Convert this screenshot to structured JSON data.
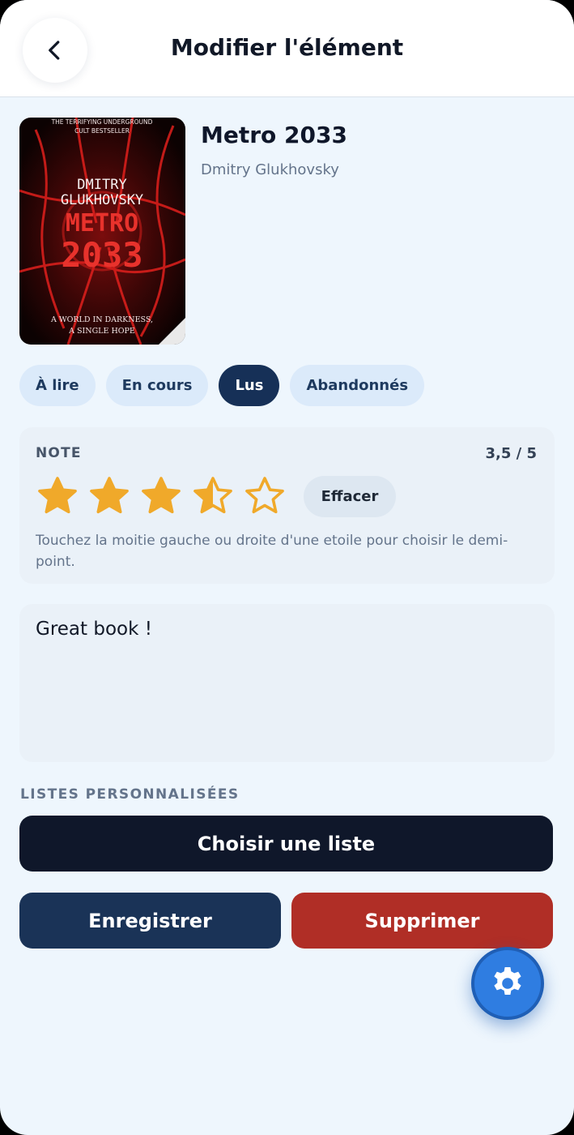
{
  "header": {
    "title": "Modifier l'élément",
    "back_icon": "chevron-left-icon"
  },
  "book": {
    "title": "Metro 2033",
    "author": "Dmitry Glukhovsky",
    "cover": {
      "tagline_top_1": "THE TERRIFYING UNDERGROUND",
      "tagline_top_2": "CULT BESTSELLER",
      "author_line_1": "DMITRY",
      "author_line_2": "GLUKHOVSKY",
      "title_line_1": "METRO",
      "title_line_2": "2033",
      "tagline_bottom_1": "A WORLD IN DARKNESS,",
      "tagline_bottom_2": "A SINGLE HOPE"
    }
  },
  "status": {
    "options": [
      "À lire",
      "En cours",
      "Lus",
      "Abandonnés"
    ],
    "selected": "Lus"
  },
  "rating": {
    "label": "NOTE",
    "display": "3,5 / 5",
    "value": 3.5,
    "max": 5,
    "clear_label": "Effacer",
    "hint": "Touchez la moitie gauche ou droite d'une etoile pour choisir le demi-point.",
    "star_color": "#f0a92a"
  },
  "notes": {
    "value": "Great book !"
  },
  "lists": {
    "label": "LISTES PERSONNALISÉES",
    "choose_label": "Choisir une liste"
  },
  "actions": {
    "save_label": "Enregistrer",
    "delete_label": "Supprimer"
  },
  "fab": {
    "icon": "gear-icon",
    "color": "#2f7de1"
  },
  "colors": {
    "accent_dark": "#163057",
    "danger": "#b02e26",
    "background": "#eef6fd"
  }
}
